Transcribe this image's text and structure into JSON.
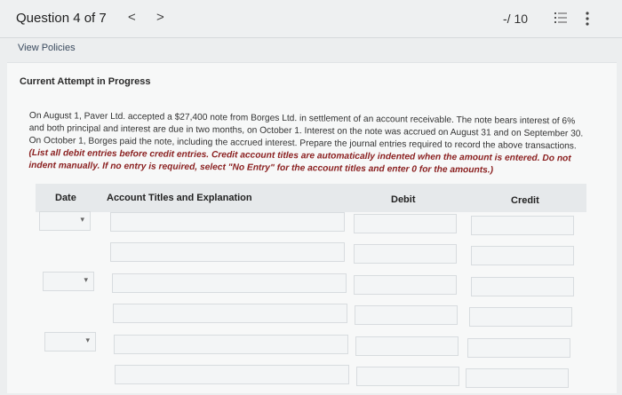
{
  "header": {
    "question_label": "Question 4 of 7",
    "prev_symbol": "<",
    "next_symbol": ">",
    "score": "-/ 10"
  },
  "links": {
    "view_policies": "View Policies"
  },
  "attempt_title": "Current Attempt in Progress",
  "question_text": "On August 1, Paver Ltd. accepted a $27,400 note from Borges Ltd. in settlement of an account receivable. The note bears interest of 6% and both principal and interest are due in two months, on October 1. Interest on the note was accrued on August 31 and on September 30. On October 1, Borges paid the note, including the accrued interest. Prepare the journal entries required to record the above transactions.",
  "instructions": "(List all debit entries before credit entries. Credit account titles are automatically indented when the amount is entered. Do not indent manually. If no entry is required, select \"No Entry\" for the account titles and enter 0 for the amounts.)",
  "table": {
    "headers": {
      "date": "Date",
      "account": "Account Titles and Explanation",
      "debit": "Debit",
      "credit": "Credit"
    }
  }
}
